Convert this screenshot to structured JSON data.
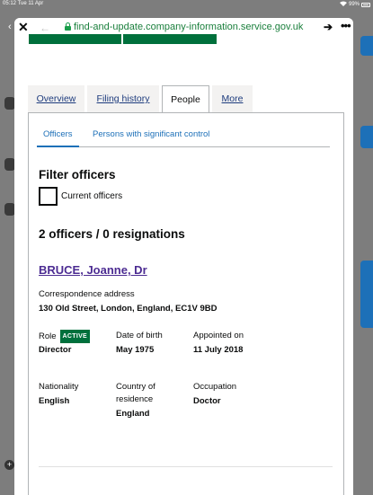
{
  "status_bar": {
    "time": "05:12 Tue 11 Apr",
    "battery": "99%"
  },
  "browser": {
    "url": "find-and-update.company-information.service.gov.uk"
  },
  "tabs": [
    {
      "label": "Overview"
    },
    {
      "label": "Filing history"
    },
    {
      "label": "People"
    },
    {
      "label": "More"
    }
  ],
  "subtabs": [
    {
      "label": "Officers"
    },
    {
      "label": "Persons with significant control"
    }
  ],
  "filter": {
    "title": "Filter officers",
    "checkbox_label": "Current officers"
  },
  "summary": {
    "heading": "2 officers / 0 resignations"
  },
  "officer": {
    "name": "BRUCE, Joanne, Dr",
    "address_label": "Correspondence address",
    "address": "130 Old Street, London, England, EC1V 9BD",
    "role_label": "Role",
    "status_badge": "ACTIVE",
    "role": "Director",
    "dob_label": "Date of birth",
    "dob": "May 1975",
    "appointed_label": "Appointed on",
    "appointed": "11 July 2018",
    "nationality_label": "Nationality",
    "nationality": "English",
    "country_label_line1": "Country of",
    "country_label_line2": "residence",
    "country": "England",
    "occupation_label": "Occupation",
    "occupation": "Doctor"
  },
  "colors": {
    "link": "#1d70b8",
    "visited": "#4c2c92",
    "active_badge": "#00703c",
    "url_green": "#1a7f3c"
  }
}
